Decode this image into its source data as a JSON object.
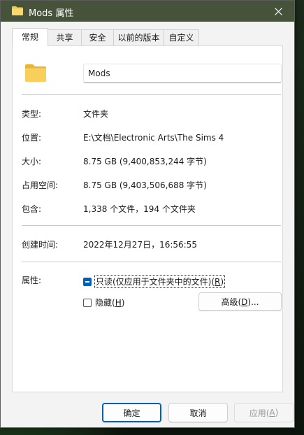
{
  "window": {
    "title": "Mods 属性",
    "title_icon": "folder-icon",
    "close_icon": "close-icon",
    "titlebar_color": "#46523a"
  },
  "tabs": [
    {
      "label": "常规",
      "active": true
    },
    {
      "label": "共享",
      "active": false
    },
    {
      "label": "安全",
      "active": false
    },
    {
      "label": "以前的版本",
      "active": false
    },
    {
      "label": "自定义",
      "active": false
    }
  ],
  "general": {
    "folder_icon": "folder-icon",
    "name_value": "Mods",
    "type": {
      "label": "类型:",
      "value": "文件夹"
    },
    "location": {
      "label": "位置:",
      "value": "E:\\文档\\Electronic Arts\\The Sims 4"
    },
    "size": {
      "label": "大小:",
      "value": "8.75 GB (9,400,853,244 字节)"
    },
    "size_on_disk": {
      "label": "占用空间:",
      "value": "8.75 GB (9,403,506,688 字节)"
    },
    "contains": {
      "label": "包含:",
      "value": "1,338 个文件，194 个文件夹"
    },
    "created": {
      "label": "创建时间:",
      "value": "2022年12月27日，16:56:55"
    },
    "attributes": {
      "label": "属性:",
      "readonly": {
        "text": "只读(仅应用于文件夹中的文件)(",
        "key": "R",
        "suffix": ")",
        "state": "indeterminate"
      },
      "hidden": {
        "text": "隐藏(",
        "key": "H",
        "suffix": ")",
        "state": "unchecked"
      },
      "advanced": {
        "text": "高级(",
        "key": "D",
        "suffix": ")..."
      }
    }
  },
  "buttons": {
    "ok": "确定",
    "cancel": "取消",
    "apply_text": "应用(",
    "apply_key": "A",
    "apply_suffix": ")"
  },
  "colors": {
    "accent": "#005fb8",
    "folder": "#f4c84e"
  }
}
